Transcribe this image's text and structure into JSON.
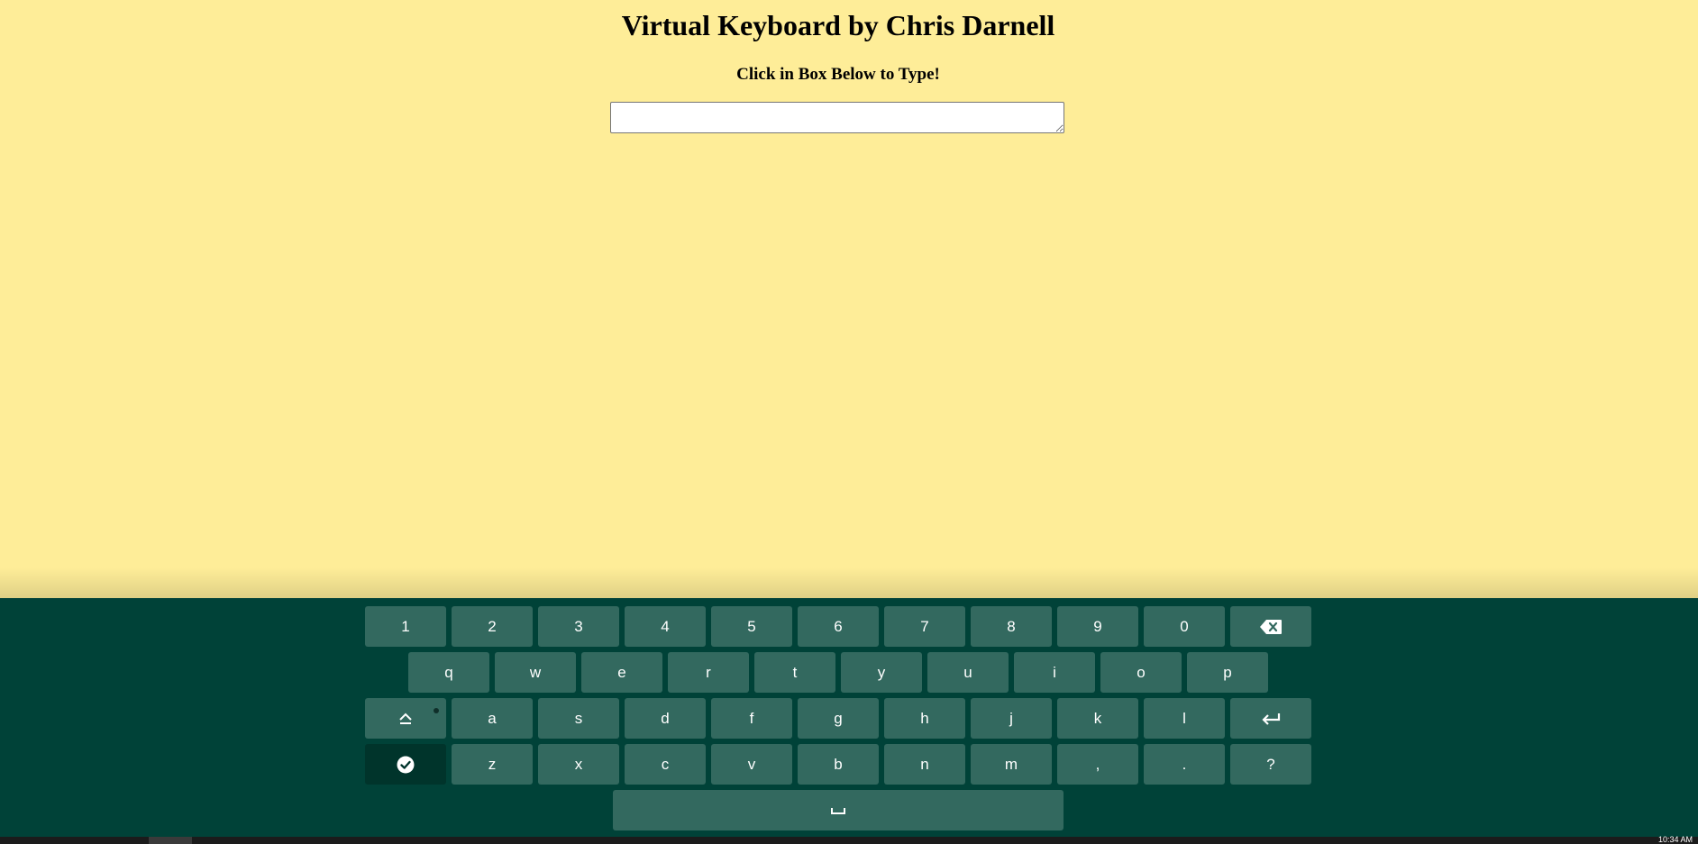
{
  "page": {
    "title": "Virtual Keyboard by Chris Darnell",
    "subtitle": "Click in Box Below to Type!",
    "textarea_value": ""
  },
  "colors": {
    "background": "#feed98",
    "keyboard_bg": "#004238",
    "key_bg": "#33695f",
    "key_dark_bg": "#00342b",
    "key_text": "#ffffff"
  },
  "keyboard": {
    "row1": [
      "1",
      "2",
      "3",
      "4",
      "5",
      "6",
      "7",
      "8",
      "9",
      "0"
    ],
    "row2": [
      "q",
      "w",
      "e",
      "r",
      "t",
      "y",
      "u",
      "i",
      "o",
      "p"
    ],
    "row3": [
      "a",
      "s",
      "d",
      "f",
      "g",
      "h",
      "j",
      "k",
      "l"
    ],
    "row4": [
      "z",
      "x",
      "c",
      "v",
      "b",
      "n",
      "m",
      ",",
      ".",
      "?"
    ],
    "icons": {
      "backspace": "backspace-icon",
      "shift": "shift-icon",
      "enter": "enter-icon",
      "done": "check-circle-icon",
      "space": "space-bar-icon"
    }
  },
  "taskbar": {
    "clock": "10:34 AM"
  }
}
